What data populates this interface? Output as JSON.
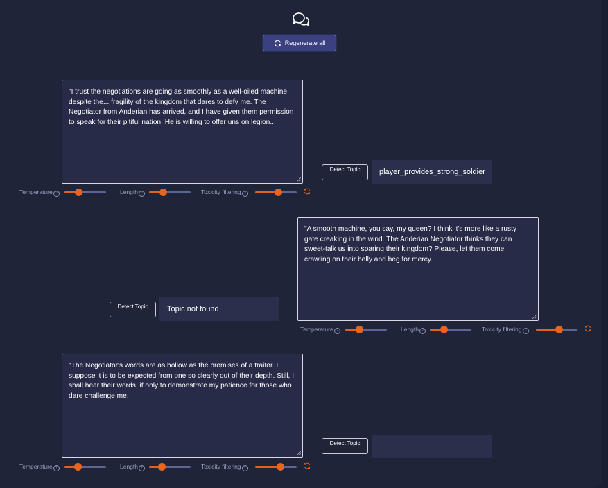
{
  "header": {
    "icon": "chat-bubbles-icon",
    "regenerate_label": "Regenerate all"
  },
  "colors": {
    "accent": "#e8641f",
    "button": "#3b4080",
    "background": "#1f2438"
  },
  "messages": [
    {
      "text": "\"I trust the negotiations are going as smoothly as a well-oiled machine, despite the... fragility of the kingdom that dares to defy me. The Negotiator from Anderian has arrived, and I have given them permission to speak for their pitiful nation. He is willing to offer uns on legion...",
      "detect_label": "Detect Topic",
      "topic": "player_provides_strong_soldier",
      "controls": {
        "temperature_label": "Temperature",
        "length_label": "Length",
        "toxicity_label": "Toxicity filtering",
        "temperature": 0.33,
        "length": 0.33,
        "toxicity": 0.55
      }
    },
    {
      "text": "\"A smooth machine, you say, my queen?  I think it's more like a rusty gate creaking in the wind. The Anderian Negotiator thinks they can sweet-talk us into sparing their kingdom? Please, let them come crawling on their belly and beg for mercy.",
      "detect_label": "Detect Topic",
      "topic": "Topic not found",
      "controls": {
        "temperature_label": "Temperature",
        "length_label": "Length",
        "toxicity_label": "Toxicity filtering",
        "temperature": 0.33,
        "length": 0.33,
        "toxicity": 0.55
      }
    },
    {
      "text": "\"The Negotiator's words are as hollow as the promises of a traitor. I suppose it is to be expected from one so clearly out of their depth. Still, I shall hear their words, if only to demonstrate my patience for those who dare challenge me.",
      "detect_label": "Detect Topic",
      "topic": "",
      "controls": {
        "temperature_label": "Temperature",
        "length_label": "Length",
        "toxicity_label": "Toxicity filtering",
        "temperature": 0.33,
        "length": 0.33,
        "toxicity": 0.6
      }
    }
  ]
}
